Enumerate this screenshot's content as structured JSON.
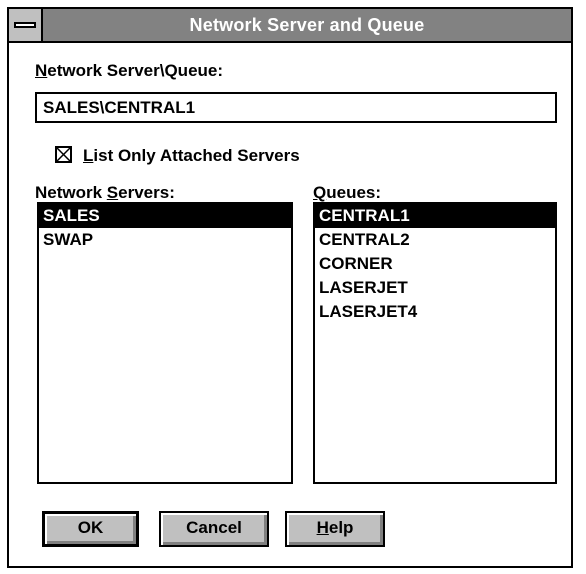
{
  "window": {
    "title": "Network Server and Queue"
  },
  "server_queue": {
    "label_mnemonic": "N",
    "label_rest": "etwork Server\\Queue:",
    "value": "SALES\\CENTRAL1"
  },
  "attached_only": {
    "checked": true,
    "label_mnemonic": "L",
    "label_rest": "ist Only Attached Servers"
  },
  "servers": {
    "label_prefix": "Network ",
    "label_mnemonic": "S",
    "label_rest": "ervers:",
    "items": [
      {
        "label": "SALES",
        "selected": true
      },
      {
        "label": "SWAP",
        "selected": false
      }
    ]
  },
  "queues": {
    "label_mnemonic": "Q",
    "label_rest": "ueues:",
    "items": [
      {
        "label": "CENTRAL1",
        "selected": true
      },
      {
        "label": "CENTRAL2",
        "selected": false
      },
      {
        "label": "CORNER",
        "selected": false
      },
      {
        "label": "LASERJET",
        "selected": false
      },
      {
        "label": "LASERJET4",
        "selected": false
      }
    ]
  },
  "buttons": {
    "ok": "OK",
    "cancel": "Cancel",
    "help_mnemonic": "H",
    "help_rest": "elp"
  }
}
